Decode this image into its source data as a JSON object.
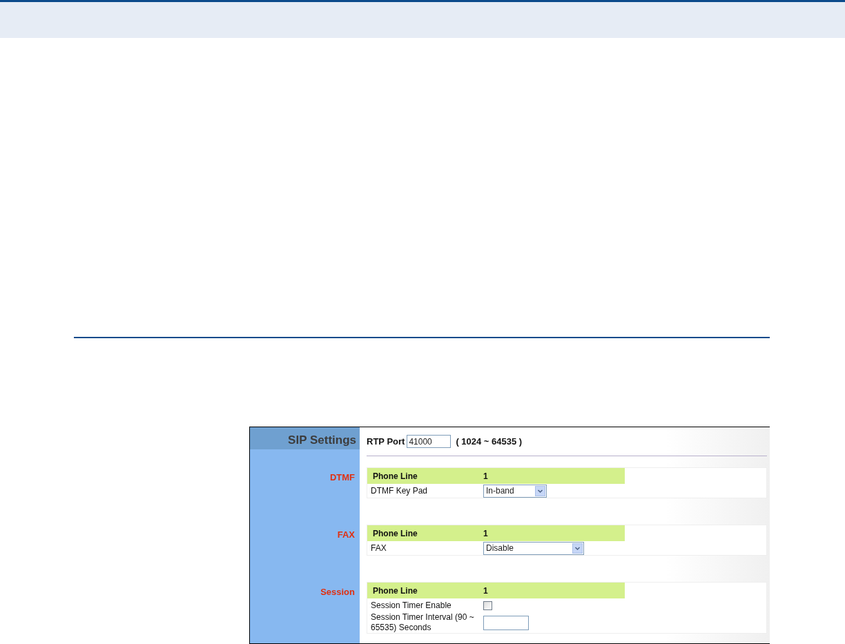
{
  "panel": {
    "title": "SIP Settings",
    "rtp_port": {
      "label": "RTP Port",
      "value": "41000",
      "range": "( 1024 ~ 64535 )"
    }
  },
  "sections": [
    {
      "label": "DTMF",
      "header": {
        "label": "Phone Line",
        "value": "1"
      },
      "rows": [
        {
          "kind": "select",
          "label": "DTMF Key Pad",
          "value": "In-band",
          "wide": false
        }
      ]
    },
    {
      "label": "FAX",
      "header": {
        "label": "Phone Line",
        "value": "1"
      },
      "rows": [
        {
          "kind": "select",
          "label": "FAX",
          "value": "Disable",
          "wide": true
        }
      ]
    },
    {
      "label": "Session",
      "header": {
        "label": "Phone Line",
        "value": "1"
      },
      "rows": [
        {
          "kind": "checkbox",
          "label": "Session Timer Enable",
          "checked": false
        },
        {
          "kind": "input",
          "label": "Session Timer Interval (90 ~ 65535) Seconds"
        }
      ]
    }
  ]
}
